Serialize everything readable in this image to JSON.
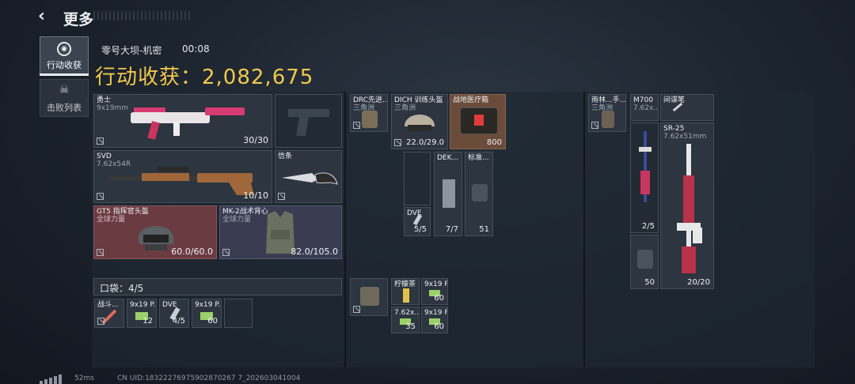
{
  "header": {
    "back_icon": "back-arrow-icon",
    "title": "更多"
  },
  "tabs": [
    {
      "label": "行动收获",
      "icon": "loot-icon",
      "active": true
    },
    {
      "label": "击败列表",
      "icon": "skull-icon",
      "active": false
    }
  ],
  "match": {
    "map": "零号大坝-机密",
    "time": "00:08"
  },
  "loot": {
    "title": "行动收获：2,082,675",
    "title_color": "#f2c94c"
  },
  "gear": {
    "primary": {
      "name": "勇士",
      "sub": "9x19mm",
      "count": "30/30"
    },
    "secondary": {
      "name": "SVD",
      "sub": "7.62x54R",
      "count": "10/10"
    },
    "melee": {
      "name": "信条"
    },
    "helmet": {
      "name": "GT5 指挥官头盔",
      "sub": "全球力量",
      "count": "60.0/60.0"
    },
    "armor": {
      "name": "MK-2战术背心",
      "sub": "全球力量",
      "count": "82.0/105.0"
    }
  },
  "pocket": {
    "label": "口袋：4/5",
    "items": [
      {
        "name": "战斗...",
        "count": ""
      },
      {
        "name": "9x19 P...",
        "count": "12"
      },
      {
        "name": "DVE",
        "count": "4/5"
      },
      {
        "name": "9x19 P...",
        "count": "60"
      }
    ]
  },
  "column2": {
    "items": [
      {
        "name": "DRC先进...",
        "sub": "三角洲"
      },
      {
        "name": "DICH 训练头盔",
        "sub": "三角洲",
        "count": "22.0/29.0"
      },
      {
        "name": "战地医疗箱",
        "count": "800"
      },
      {
        "name": "DEK...",
        "count": "7/7"
      },
      {
        "name": "标准...",
        "count": "51"
      },
      {
        "name": "DVE",
        "count": "5/5"
      }
    ],
    "lower": [
      {
        "name": "柠檬茶",
        "count": ""
      },
      {
        "name": "9x19 P...",
        "count": "60"
      },
      {
        "name": "7.62x...",
        "count": "35"
      },
      {
        "name": "9x19 P...",
        "count": "60"
      }
    ]
  },
  "column3": {
    "items": [
      {
        "name": "雨林...手...",
        "sub": "三角洲"
      },
      {
        "name": "M700",
        "sub": "7.62x..."
      },
      {
        "name": "间谍笔"
      },
      {
        "name": "SR-25",
        "sub": "7.62x51mm",
        "count": "20/20"
      },
      {
        "name": "",
        "count": "2/5"
      },
      {
        "name": "",
        "count": "50"
      }
    ]
  },
  "footer": {
    "ping": "52ms",
    "uid": "CN UID:18322276975902870267 7_202603041004"
  }
}
